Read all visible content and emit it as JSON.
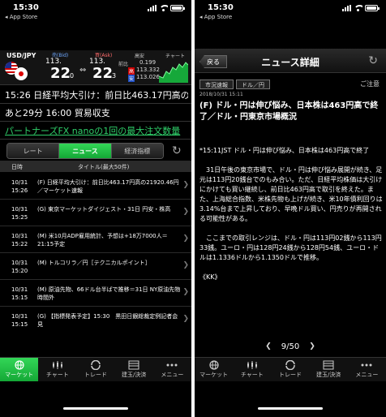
{
  "status_bar": {
    "time": "15:30",
    "back_app": "◂ App Store"
  },
  "left": {
    "rate": {
      "pair": "USD/JPY",
      "bid_label": "売(Bid)",
      "ask_label": "買(Ask)",
      "bid_main": "113.",
      "bid_big": "22",
      "bid_frac": "0",
      "ask_main": "113.",
      "ask_big": "22",
      "ask_frac": "3",
      "high_label": "高安",
      "prev_label": "前比",
      "high_tag": "高",
      "low_tag": "安",
      "change": "0.199",
      "high": "113.332",
      "low": "113.026",
      "chart_label": "チャート",
      "spread_marker": "⇔"
    },
    "tickers": [
      "15:26 日経平均大引け：前日比463.17円高の21920.46円",
      "あと29分 16:00 貿易収支",
      "パートナーズFX nanoの1回の最大注文数量"
    ],
    "tabs": [
      "レート",
      "ニュース",
      "経済指標"
    ],
    "active_tab": "ニュース",
    "list_header": {
      "date": "日時",
      "title": "タイトル(最大50件)"
    },
    "news": [
      {
        "date": "10/31",
        "time": "15:26",
        "title": "(F) 日経平均大引け：前日比463.17円高の21920.46円／マーケット速報"
      },
      {
        "date": "10/31",
        "time": "15:25",
        "title": "(G) 東京マーケットダイジェスト・31日 円安・株高"
      },
      {
        "date": "10/31",
        "time": "15:22",
        "title": "(M) 米10月ADP雇用統計、予想は+18万7000人＝21:15予定"
      },
      {
        "date": "10/31",
        "time": "15:20",
        "title": "(M) トルコリラ／円［テクニカルポイント］"
      },
      {
        "date": "10/31",
        "time": "15:15",
        "title": "(M) 原油先物、66ドル台半ばで推移＝31日 NY原油先物時間外"
      },
      {
        "date": "10/31",
        "time": "15:15",
        "title": "(G) 【指標発表予定】15:30　黒田日銀総裁定例記者会見"
      }
    ]
  },
  "right": {
    "back_label": "戻る",
    "title": "ニュース詳細",
    "tags": [
      "市況速報",
      "ドル／円"
    ],
    "caution": "ご注意",
    "date": "2018/10/31 15:11",
    "headline": "(F) ドル・円は伸び悩み、日本株は463円高で終了／ドル・円東京市場概況",
    "paragraphs": [
      "*15:11JST ドル・円は伸び悩み、日本株は463円高で終了",
      "　31日午後の東京市場で、ドル・円は伸び悩み展開が続き、足元は113円20銭台でのもみ合い。ただ、日経平均株価は大引けにかけても買い継続し、前日比463円高で取引を終えた。また、上海総合指数、米株先物も上げが続き、米10年債利回りは3.14%台まで上昇しており、早晩ドル買い、円売りが再開される可能性がある。",
      "　ここまでの取引レンジは、ドル・円は113円02銭から113円33銭。ユーロ・円は128円24銭から128円54銭、ユーロ・ドルは1.1336ドルから1.1350ドルで推移。",
      "《KK》"
    ],
    "pager": "9/50"
  },
  "nav": [
    "マーケット",
    "チャート",
    "トレード",
    "建玉/決済",
    "メニュー"
  ],
  "colors": {
    "accent_green": "#22c24a",
    "bid_blue": "#6fa8ff",
    "ask_red": "#ff6b6b"
  }
}
